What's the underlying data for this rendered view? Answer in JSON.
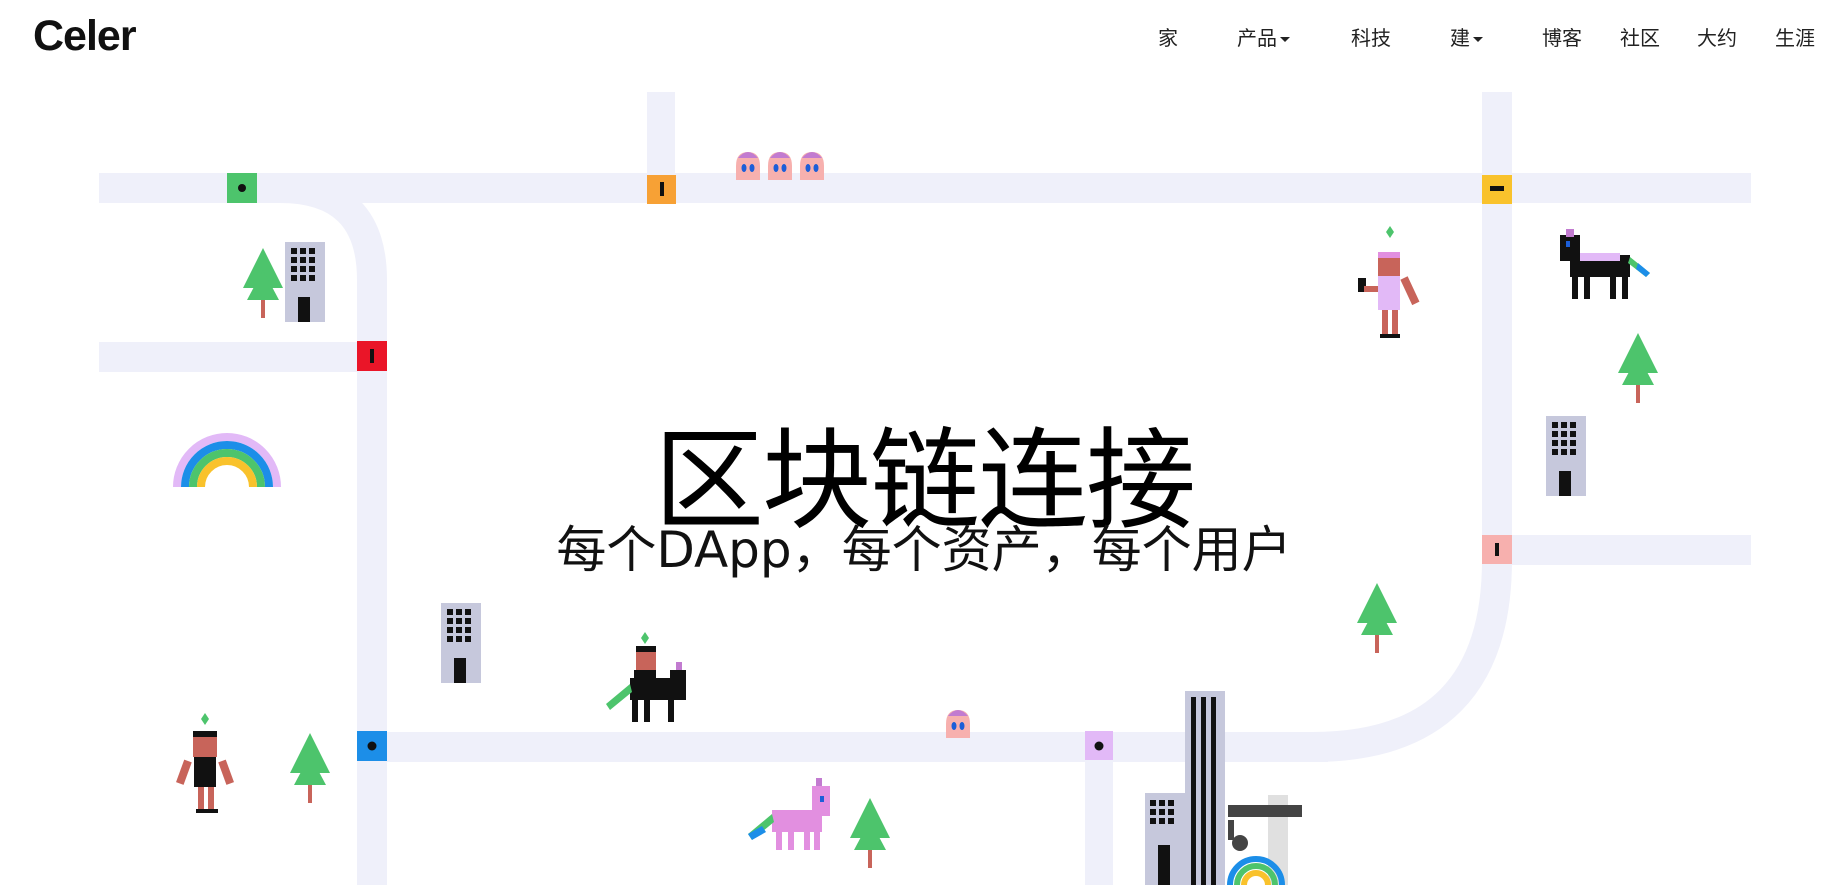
{
  "header": {
    "logo": "Celer",
    "nav": [
      {
        "label": "家",
        "dropdown": false
      },
      {
        "label": "产品",
        "dropdown": true
      },
      {
        "label": "科技",
        "dropdown": false
      },
      {
        "label": "建",
        "dropdown": true
      },
      {
        "label": "博客",
        "dropdown": false
      },
      {
        "label": "社区",
        "dropdown": false
      },
      {
        "label": "大约",
        "dropdown": false
      },
      {
        "label": "生涯",
        "dropdown": false
      }
    ]
  },
  "hero": {
    "title": "区块链连接",
    "subtitle": "每个DApp，每个资产，每个用户"
  },
  "colors": {
    "road": "#eff0fa",
    "station_green": "#4dc46c",
    "station_orange": "#f7a135",
    "station_yellow": "#f9c22c",
    "station_red": "#ea1528",
    "station_blue": "#1c8ee8",
    "station_pink": "#f7b0ae",
    "station_lilac": "#e2b9f7",
    "tree": "#4dc46c",
    "building": "#c6c8dc"
  },
  "icons": [
    "tree-icon",
    "building-icon",
    "rainbow-icon",
    "unicorn-icon",
    "person-icon",
    "ghost-icon",
    "crane-icon"
  ]
}
